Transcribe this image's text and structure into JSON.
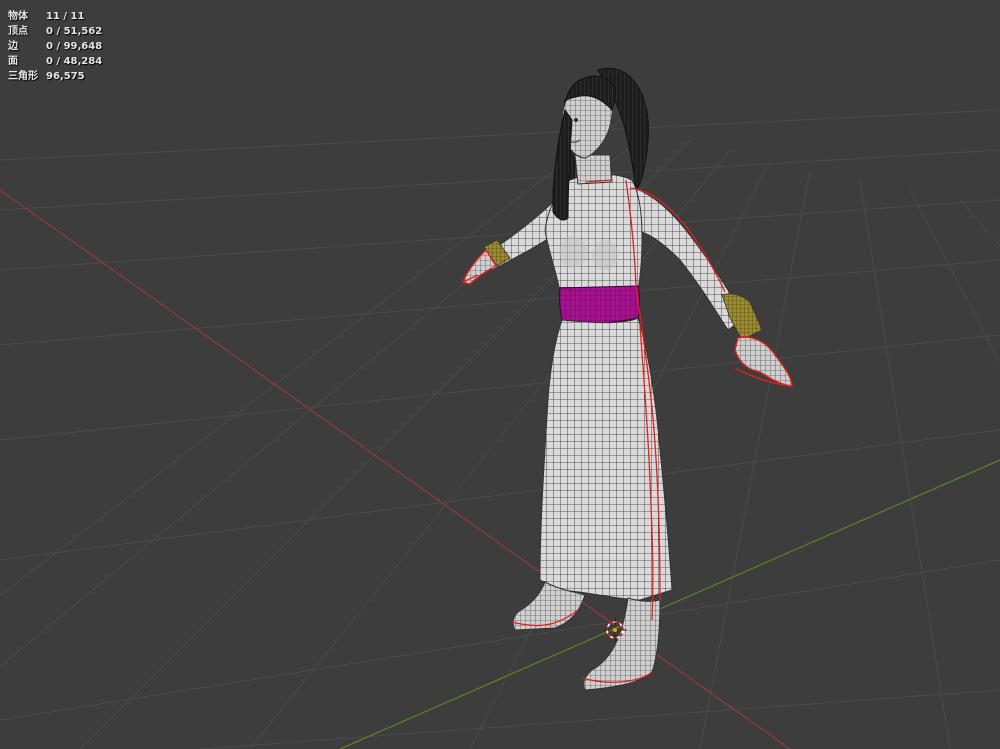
{
  "stats": [
    {
      "label": "物体",
      "value": "11 / 11"
    },
    {
      "label": "顶点",
      "value": "0 / 51,562"
    },
    {
      "label": "边",
      "value": "0 / 99,648"
    },
    {
      "label": "面",
      "value": "0 / 48,284"
    },
    {
      "label": "三角形",
      "value": "96,575"
    }
  ],
  "colors": {
    "background": "#3d3d3d",
    "grid": "#4a4a4a",
    "x_axis": "#8a3a44",
    "y_axis": "#5a7a2a",
    "mesh_fill": "#d9d9d9",
    "wire": "#222222",
    "hair": "#1c1c1c",
    "sash": "#a0108c",
    "bracelet": "#9a8a30",
    "seam": "#e02020",
    "cursor": "#ff4040"
  },
  "objects": {
    "figure": "character-mesh-icon",
    "cursor": "3d-cursor-icon"
  }
}
